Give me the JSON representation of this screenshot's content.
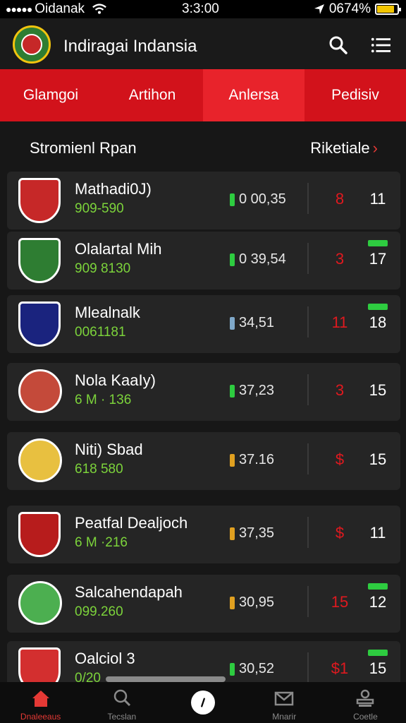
{
  "status_bar": {
    "carrier": "Oidanak",
    "time": "3:3:00",
    "battery": "0674%",
    "battery_level": 0.85
  },
  "header": {
    "title": "Indiragai Indansia",
    "icons": [
      "search-icon",
      "menu-icon"
    ]
  },
  "tabs": [
    {
      "label": "Glamgoi",
      "active": false
    },
    {
      "label": "Artihon",
      "active": false
    },
    {
      "label": "Anlersa",
      "active": true
    },
    {
      "label": "Pedisiv",
      "active": false
    }
  ],
  "section": {
    "title": "Stromienl Rpan",
    "link": "Riketiale",
    "link_icon": "chevron-right-icon"
  },
  "rows": [
    {
      "name": "Mathadi0J)",
      "sub": "909-590",
      "value": "0 00,35",
      "value_icon_color": "#2ecc40",
      "stat": "8",
      "score": "11",
      "badge": false,
      "avatar": "crest",
      "avatar_color": "#c62828"
    },
    {
      "name": "Olalartal Mih",
      "sub": "909 8130",
      "value": "0 39,54",
      "value_icon_color": "#2ecc40",
      "stat": "3",
      "score": "17",
      "badge": true,
      "avatar": "crest",
      "avatar_color": "#2e7d32"
    },
    {
      "name": "Mlealnalk",
      "sub": "0061181",
      "value": "34,51",
      "value_icon_color": "#7fa8c9",
      "stat": "11",
      "score": "18",
      "badge": true,
      "avatar": "crest",
      "avatar_color": "#1a237e"
    },
    {
      "name": "Nola KaaIy)",
      "sub": "6 M · 136",
      "value": "37,23",
      "value_icon_color": "#2ecc40",
      "stat": "3",
      "score": "15",
      "badge": false,
      "avatar": "player",
      "avatar_color": "#c44a3a"
    },
    {
      "name": "Niti) Sbad",
      "sub": "618 580",
      "value": "37.16",
      "value_icon_color": "#e0a020",
      "stat": "$",
      "score": "15",
      "badge": false,
      "avatar": "player",
      "avatar_color": "#e8c040"
    },
    {
      "name": "Peatfal Dealjoch",
      "sub": "6 M ·216",
      "value": "37,35",
      "value_icon_color": "#e0a020",
      "stat": "$",
      "score": "11",
      "badge": false,
      "avatar": "crest",
      "avatar_color": "#b71c1c"
    },
    {
      "name": "Salcahendapah",
      "sub": "099.260",
      "value": "30,95",
      "value_icon_color": "#e0a020",
      "stat": "15",
      "score": "12",
      "badge": true,
      "avatar": "player",
      "avatar_color": "#4caf50"
    },
    {
      "name": "Oalciol 3",
      "sub": "0/20",
      "value": "30,52",
      "value_icon_color": "#2ecc40",
      "stat": "$1",
      "score": "15",
      "badge": true,
      "avatar": "crest",
      "avatar_color": "#d32f2f"
    }
  ],
  "bottom_nav": [
    {
      "label": "Dnaleeaus",
      "icon": "home-icon",
      "active": true
    },
    {
      "label": "Tecslan",
      "icon": "search-icon",
      "active": false
    },
    {
      "label": "",
      "icon": "compass-icon",
      "active": false
    },
    {
      "label": "Mnarir",
      "icon": "mail-icon",
      "active": false
    },
    {
      "label": "Coetle",
      "icon": "profile-icon",
      "active": false
    }
  ]
}
